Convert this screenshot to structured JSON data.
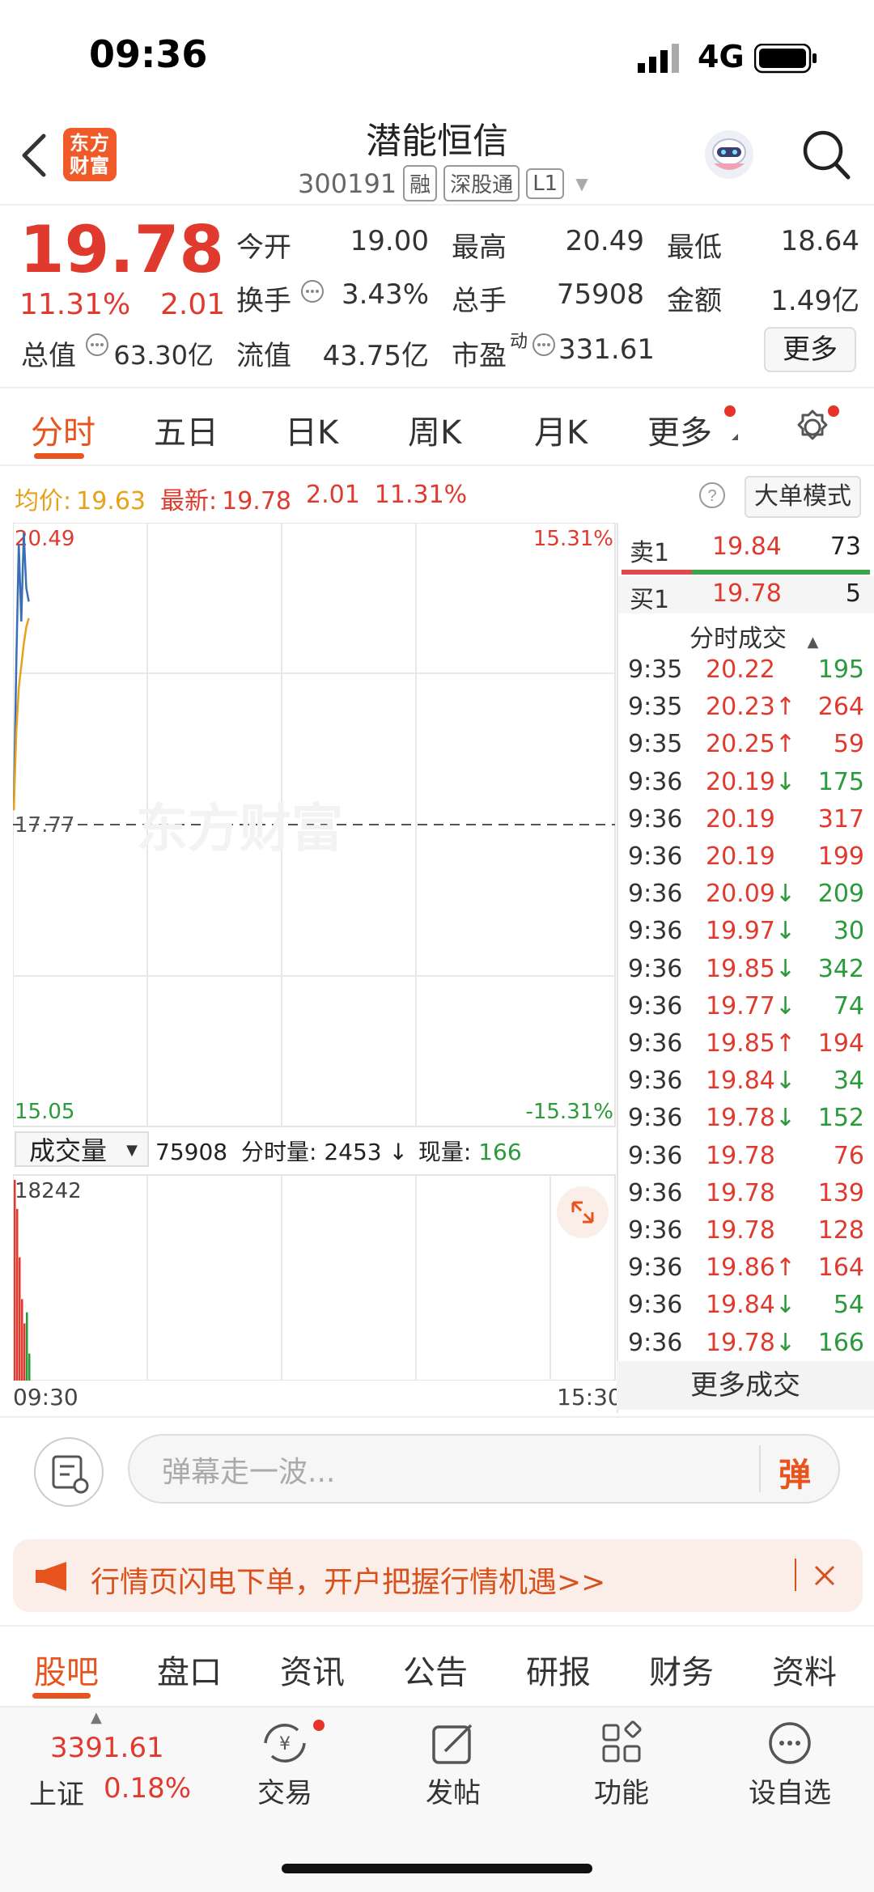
{
  "status": {
    "time": "09:36",
    "network": "4G"
  },
  "header": {
    "title": "潜能恒信",
    "code": "300191",
    "tags": [
      "融",
      "深股通",
      "L1"
    ],
    "logo_text": "东方财富"
  },
  "quote": {
    "price": "19.78",
    "change_pct": "11.31%",
    "change": "2.01",
    "fields": {
      "open_label": "今开",
      "open": "19.00",
      "high_label": "最高",
      "high": "20.49",
      "low_label": "最低",
      "low": "18.64",
      "turnover_label": "换手",
      "turnover": "3.43%",
      "volume_label": "总手",
      "volume": "75908",
      "amount_label": "金额",
      "amount": "1.49亿",
      "mktcap_label": "总值",
      "mktcap": "63.30亿",
      "float_label": "流值",
      "float": "43.75亿",
      "pe_label": "市盈",
      "pe_sup": "动",
      "pe": "331.61"
    },
    "more_label": "更多"
  },
  "chart_tabs": [
    "分时",
    "五日",
    "日K",
    "周K",
    "月K",
    "更多"
  ],
  "info_line": {
    "avg_label": "均价:",
    "avg": "19.63",
    "latest_label": "最新:",
    "latest": "19.78",
    "change": "2.01",
    "change_pct": "11.31%",
    "mode_label": "大单模式"
  },
  "chart_labels": {
    "top_price": "20.49",
    "top_pct": "15.31%",
    "mid_price": "17.77",
    "bottom_price": "15.05",
    "bottom_pct": "-15.31%",
    "watermark": "东方财富",
    "vol_max": "18242",
    "time_start": "09:30",
    "time_end": "15:30"
  },
  "chart_data": {
    "type": "line",
    "x_range": [
      "09:30",
      "15:30"
    ],
    "ylim": [
      15.05,
      20.49
    ],
    "prev_close": 17.77,
    "series": [
      {
        "color": "#3a6fb8",
        "x": [
          "09:30",
          "09:31",
          "09:32",
          "09:33",
          "09:34",
          "09:35",
          "09:36"
        ],
        "values": [
          17.9,
          19.2,
          20.3,
          19.6,
          20.4,
          19.9,
          19.78
        ]
      },
      {
        "color": "#e6a21a",
        "x": [
          "09:30",
          "09:31",
          "09:32",
          "09:33",
          "09:34",
          "09:35",
          "09:36"
        ],
        "values": [
          17.9,
          18.6,
          19.0,
          19.2,
          19.4,
          19.55,
          19.63
        ]
      }
    ],
    "volume": {
      "max": 18242,
      "bars": [
        {
          "v": 18242,
          "c": "red"
        },
        {
          "v": 15600,
          "c": "red"
        },
        {
          "v": 11200,
          "c": "red"
        },
        {
          "v": 7400,
          "c": "red"
        },
        {
          "v": 5200,
          "c": "red"
        },
        {
          "v": 6200,
          "c": "green"
        },
        {
          "v": 2453,
          "c": "green"
        }
      ]
    }
  },
  "volume_header": {
    "select_label": "成交量",
    "total": "75908",
    "minute_label": "分时量:",
    "minute": "2453",
    "now_label": "现量:",
    "now": "166"
  },
  "order_book": {
    "sell_label": "卖1",
    "sell_price": "19.84",
    "sell_vol": "73",
    "buy_label": "买1",
    "buy_price": "19.78",
    "buy_vol": "5"
  },
  "trades_title": "分时成交",
  "trades": [
    {
      "t": "9:35",
      "p": "20.22",
      "a": "",
      "v": "195",
      "vc": "green"
    },
    {
      "t": "9:35",
      "p": "20.23",
      "a": "↑",
      "v": "264",
      "vc": "red"
    },
    {
      "t": "9:35",
      "p": "20.25",
      "a": "↑",
      "v": "59",
      "vc": "red"
    },
    {
      "t": "9:36",
      "p": "20.19",
      "a": "↓",
      "v": "175",
      "vc": "green"
    },
    {
      "t": "9:36",
      "p": "20.19",
      "a": "",
      "v": "317",
      "vc": "red"
    },
    {
      "t": "9:36",
      "p": "20.19",
      "a": "",
      "v": "199",
      "vc": "red"
    },
    {
      "t": "9:36",
      "p": "20.09",
      "a": "↓",
      "v": "209",
      "vc": "green"
    },
    {
      "t": "9:36",
      "p": "19.97",
      "a": "↓",
      "v": "30",
      "vc": "green"
    },
    {
      "t": "9:36",
      "p": "19.85",
      "a": "↓",
      "v": "342",
      "vc": "green"
    },
    {
      "t": "9:36",
      "p": "19.77",
      "a": "↓",
      "v": "74",
      "vc": "green"
    },
    {
      "t": "9:36",
      "p": "19.85",
      "a": "↑",
      "v": "194",
      "vc": "red"
    },
    {
      "t": "9:36",
      "p": "19.84",
      "a": "↓",
      "v": "34",
      "vc": "green"
    },
    {
      "t": "9:36",
      "p": "19.78",
      "a": "↓",
      "v": "152",
      "vc": "green"
    },
    {
      "t": "9:36",
      "p": "19.78",
      "a": "",
      "v": "76",
      "vc": "red"
    },
    {
      "t": "9:36",
      "p": "19.78",
      "a": "",
      "v": "139",
      "vc": "red"
    },
    {
      "t": "9:36",
      "p": "19.78",
      "a": "",
      "v": "128",
      "vc": "red"
    },
    {
      "t": "9:36",
      "p": "19.86",
      "a": "↑",
      "v": "164",
      "vc": "red"
    },
    {
      "t": "9:36",
      "p": "19.84",
      "a": "↓",
      "v": "54",
      "vc": "green"
    },
    {
      "t": "9:36",
      "p": "19.78",
      "a": "↓",
      "v": "166",
      "vc": "green"
    }
  ],
  "more_trades_label": "更多成交",
  "comment": {
    "placeholder": "弹幕走一波...",
    "danmu_label": "弹"
  },
  "promo": {
    "text": "行情页闪电下单，开户把握行情机遇>>"
  },
  "bottom_tabs": [
    "股吧",
    "盘口",
    "资讯",
    "公告",
    "研报",
    "财务",
    "资料"
  ],
  "bottom_nav": {
    "index_value": "3391.61",
    "index_name": "上证",
    "index_pct": "0.18%",
    "items": [
      "交易",
      "发帖",
      "功能",
      "设自选"
    ]
  },
  "colors": {
    "up": "#e03a2f",
    "down": "#2a9a3a",
    "accent": "#e8541e",
    "avg": "#e6a21a",
    "price_line": "#3a6fb8"
  },
  "icons": [
    "back-icon",
    "logo-icon",
    "robot-avatar-icon",
    "search-icon",
    "settings-gear-icon",
    "help-icon",
    "expand-icon",
    "note-icon",
    "megaphone-icon",
    "close-icon",
    "trade-icon",
    "post-edit-icon",
    "apps-icon",
    "more-dots-icon"
  ]
}
